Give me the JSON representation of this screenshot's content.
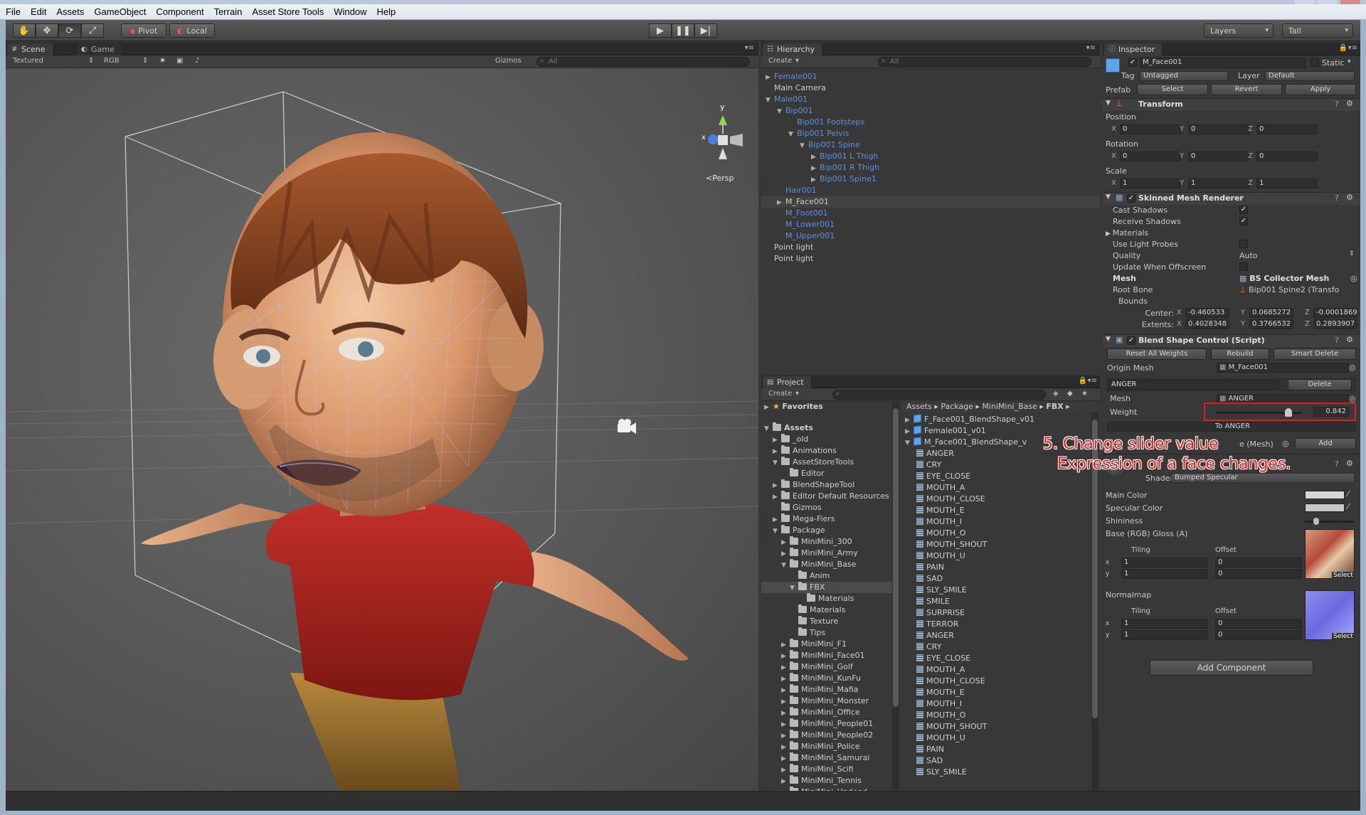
{
  "menu": [
    "File",
    "Edit",
    "Assets",
    "GameObject",
    "Component",
    "Terrain",
    "Asset Store Tools",
    "Window",
    "Help"
  ],
  "toolbar": {
    "pivot": "Pivot",
    "local": "Local",
    "layers": "Layers",
    "layout": "Tall"
  },
  "scene": {
    "tab_scene": "Scene",
    "tab_game": "Game",
    "render_mode": "Textured",
    "color_mode": "RGB",
    "gizmos": "Gizmos",
    "search_placeholder": "All",
    "persp_label": "Persp",
    "axis_y": "y",
    "axis_x": "x"
  },
  "hierarchy": {
    "title": "Hierarchy",
    "create": "Create",
    "search_placeholder": "All",
    "rows": [
      {
        "label": "Female001",
        "indent": 0,
        "arrow": "▶",
        "blue": true
      },
      {
        "label": "Main Camera",
        "indent": 0,
        "arrow": "",
        "blue": false
      },
      {
        "label": "Male001",
        "indent": 0,
        "arrow": "▼",
        "blue": true
      },
      {
        "label": "Bip001",
        "indent": 1,
        "arrow": "▼",
        "blue": true
      },
      {
        "label": "Bip001 Footsteps",
        "indent": 2,
        "arrow": "",
        "blue": true
      },
      {
        "label": "Bip001 Pelvis",
        "indent": 2,
        "arrow": "▼",
        "blue": true
      },
      {
        "label": "Bip001 Spine",
        "indent": 3,
        "arrow": "▼",
        "blue": true
      },
      {
        "label": "Bip001 L Thigh",
        "indent": 4,
        "arrow": "▶",
        "blue": true
      },
      {
        "label": "Bip001 R Thigh",
        "indent": 4,
        "arrow": "▶",
        "blue": true
      },
      {
        "label": "Bip001 Spine1",
        "indent": 4,
        "arrow": "▶",
        "blue": true
      },
      {
        "label": "Hair001",
        "indent": 1,
        "arrow": "",
        "blue": true
      },
      {
        "label": "M_Face001",
        "indent": 1,
        "arrow": "▶",
        "blue": false,
        "selected": true
      },
      {
        "label": "M_Foot001",
        "indent": 1,
        "arrow": "",
        "blue": true
      },
      {
        "label": "M_Lower001",
        "indent": 1,
        "arrow": "",
        "blue": true
      },
      {
        "label": "M_Upper001",
        "indent": 1,
        "arrow": "",
        "blue": true
      },
      {
        "label": "Point light",
        "indent": 0,
        "arrow": "",
        "blue": false
      },
      {
        "label": "Point light",
        "indent": 0,
        "arrow": "",
        "blue": false
      }
    ]
  },
  "project": {
    "title": "Project",
    "create": "Create",
    "favorites": "Favorites",
    "assets": "Assets",
    "breadcrumb": [
      "Assets",
      "Package",
      "MiniMini_Base",
      "FBX"
    ],
    "tree": [
      {
        "label": "_old",
        "indent": 1,
        "arrow": "▶"
      },
      {
        "label": "Animations",
        "indent": 1,
        "arrow": "▶"
      },
      {
        "label": "AssetStoreTools",
        "indent": 1,
        "arrow": "▼"
      },
      {
        "label": "Editor",
        "indent": 2,
        "arrow": ""
      },
      {
        "label": "BlendShapeTool",
        "indent": 1,
        "arrow": "▶"
      },
      {
        "label": "Editor Default Resources",
        "indent": 1,
        "arrow": "▶"
      },
      {
        "label": "Gizmos",
        "indent": 1,
        "arrow": ""
      },
      {
        "label": "Mega-Fiers",
        "indent": 1,
        "arrow": "▶"
      },
      {
        "label": "Package",
        "indent": 1,
        "arrow": "▼"
      },
      {
        "label": "MiniMini_300",
        "indent": 2,
        "arrow": "▶"
      },
      {
        "label": "MiniMini_Army",
        "indent": 2,
        "arrow": "▶"
      },
      {
        "label": "MiniMini_Base",
        "indent": 2,
        "arrow": "▼"
      },
      {
        "label": "Anim",
        "indent": 3,
        "arrow": ""
      },
      {
        "label": "FBX",
        "indent": 3,
        "arrow": "▼",
        "selected": true
      },
      {
        "label": "Materials",
        "indent": 4,
        "arrow": ""
      },
      {
        "label": "Materials",
        "indent": 3,
        "arrow": ""
      },
      {
        "label": "Texture",
        "indent": 3,
        "arrow": ""
      },
      {
        "label": "Tips",
        "indent": 3,
        "arrow": ""
      },
      {
        "label": "MiniMini_F1",
        "indent": 2,
        "arrow": "▶"
      },
      {
        "label": "MiniMini_Face01",
        "indent": 2,
        "arrow": "▶"
      },
      {
        "label": "MiniMini_Golf",
        "indent": 2,
        "arrow": "▶"
      },
      {
        "label": "MiniMini_KunFu",
        "indent": 2,
        "arrow": "▶"
      },
      {
        "label": "MiniMini_Mafia",
        "indent": 2,
        "arrow": "▶"
      },
      {
        "label": "MiniMini_Monster",
        "indent": 2,
        "arrow": "▶"
      },
      {
        "label": "MiniMini_Office",
        "indent": 2,
        "arrow": "▶"
      },
      {
        "label": "MiniMini_People01",
        "indent": 2,
        "arrow": "▶"
      },
      {
        "label": "MiniMini_People02",
        "indent": 2,
        "arrow": "▶"
      },
      {
        "label": "MiniMini_Police",
        "indent": 2,
        "arrow": "▶"
      },
      {
        "label": "MiniMini_Samurai",
        "indent": 2,
        "arrow": "▶"
      },
      {
        "label": "MiniMini_Scifi",
        "indent": 2,
        "arrow": "▶"
      },
      {
        "label": "MiniMini_Tennis",
        "indent": 2,
        "arrow": "▶"
      },
      {
        "label": "MiniMini_Undead",
        "indent": 2,
        "arrow": "▶"
      }
    ],
    "files": [
      {
        "label": "F_Face001_BlendShape_v01",
        "kind": "prefab",
        "arrow": "▶",
        "indent": 0
      },
      {
        "label": "Female001_v01",
        "kind": "prefab",
        "arrow": "▶",
        "indent": 0
      },
      {
        "label": "M_Face001_BlendShape_v",
        "kind": "prefab",
        "arrow": "▼",
        "indent": 0
      },
      {
        "label": "ANGER",
        "kind": "grid",
        "arrow": "",
        "indent": 1
      },
      {
        "label": "CRY",
        "kind": "grid",
        "arrow": "",
        "indent": 1
      },
      {
        "label": "EYE_CLOSE",
        "kind": "grid",
        "arrow": "",
        "indent": 1
      },
      {
        "label": "MOUTH_A",
        "kind": "grid",
        "arrow": "",
        "indent": 1
      },
      {
        "label": "MOUTH_CLOSE",
        "kind": "grid",
        "arrow": "",
        "indent": 1
      },
      {
        "label": "MOUTH_E",
        "kind": "grid",
        "arrow": "",
        "indent": 1
      },
      {
        "label": "MOUTH_I",
        "kind": "grid",
        "arrow": "",
        "indent": 1
      },
      {
        "label": "MOUTH_O",
        "kind": "grid",
        "arrow": "",
        "indent": 1
      },
      {
        "label": "MOUTH_SHOUT",
        "kind": "grid",
        "arrow": "",
        "indent": 1
      },
      {
        "label": "MOUTH_U",
        "kind": "grid",
        "arrow": "",
        "indent": 1
      },
      {
        "label": "PAIN",
        "kind": "grid",
        "arrow": "",
        "indent": 1
      },
      {
        "label": "SAD",
        "kind": "grid",
        "arrow": "",
        "indent": 1
      },
      {
        "label": "SLY_SMILE",
        "kind": "grid",
        "arrow": "",
        "indent": 1
      },
      {
        "label": "SMILE",
        "kind": "grid",
        "arrow": "",
        "indent": 1
      },
      {
        "label": "SURPRISE",
        "kind": "grid",
        "arrow": "",
        "indent": 1
      },
      {
        "label": "TERROR",
        "kind": "grid",
        "arrow": "",
        "indent": 1
      },
      {
        "label": "ANGER",
        "kind": "grid",
        "arrow": "",
        "indent": 1
      },
      {
        "label": "CRY",
        "kind": "grid",
        "arrow": "",
        "indent": 1
      },
      {
        "label": "EYE_CLOSE",
        "kind": "grid",
        "arrow": "",
        "indent": 1
      },
      {
        "label": "MOUTH_A",
        "kind": "grid",
        "arrow": "",
        "indent": 1
      },
      {
        "label": "MOUTH_CLOSE",
        "kind": "grid",
        "arrow": "",
        "indent": 1
      },
      {
        "label": "MOUTH_E",
        "kind": "grid",
        "arrow": "",
        "indent": 1
      },
      {
        "label": "MOUTH_I",
        "kind": "grid",
        "arrow": "",
        "indent": 1
      },
      {
        "label": "MOUTH_O",
        "kind": "grid",
        "arrow": "",
        "indent": 1
      },
      {
        "label": "MOUTH_SHOUT",
        "kind": "grid",
        "arrow": "",
        "indent": 1
      },
      {
        "label": "MOUTH_U",
        "kind": "grid",
        "arrow": "",
        "indent": 1
      },
      {
        "label": "PAIN",
        "kind": "grid",
        "arrow": "",
        "indent": 1
      },
      {
        "label": "SAD",
        "kind": "grid",
        "arrow": "",
        "indent": 1
      },
      {
        "label": "SLY_SMILE",
        "kind": "grid",
        "arrow": "",
        "indent": 1
      }
    ]
  },
  "inspector": {
    "title": "Inspector",
    "object_name": "M_Face001",
    "static": "Static",
    "tag_label": "Tag",
    "tag_value": "Untagged",
    "layer_label": "Layer",
    "layer_value": "Default",
    "prefab_label": "Prefab",
    "prefab_select": "Select",
    "prefab_revert": "Revert",
    "prefab_apply": "Apply",
    "transform": {
      "title": "Transform",
      "position": "Position",
      "rotation": "Rotation",
      "scale": "Scale",
      "pos": [
        "0",
        "0",
        "0"
      ],
      "rot": [
        "0",
        "0",
        "0"
      ],
      "scl": [
        "1",
        "1",
        "1"
      ]
    },
    "smr": {
      "title": "Skinned Mesh Renderer",
      "cast": "Cast Shadows",
      "receive": "Receive Shadows",
      "materials": "Materials",
      "probes": "Use Light Probes",
      "quality": "Quality",
      "quality_value": "Auto",
      "offscreen": "Update When Offscreen",
      "mesh": "Mesh",
      "mesh_value": "BS Collector Mesh",
      "rootbone": "Root Bone",
      "rootbone_value": "Bip001 Spine2 (Transfo",
      "bounds": "Bounds",
      "center": "Center:",
      "extents": "Extents:",
      "center_vals": [
        "-0.460533",
        "0.0685272",
        "-0.0001869"
      ],
      "extent_vals": [
        "0.4028348",
        "0.3766532",
        "0.2893907"
      ]
    },
    "bsc": {
      "title": "Blend Shape Control (Script)",
      "reset": "Reset All Weights",
      "rebuild": "Rebuild",
      "smart": "Smart Delete",
      "origin": "Origin Mesh",
      "origin_value": "M_Face001",
      "shape_name": "ANGER",
      "delete": "Delete",
      "mesh_label": "Mesh",
      "mesh_value": "ANGER",
      "weight_label": "Weight",
      "weight_value": "0.842",
      "weight": 0.842,
      "to_label": "To ANGER",
      "partial": "e (Mesh)",
      "add": "Add"
    },
    "material": {
      "shader_label": "Shader",
      "shader_value": "Bumped Specular",
      "main_color": "Main Color",
      "spec_color": "Specular Color",
      "shininess": "Shininess",
      "base": "Base (RGB) Gloss (A)",
      "tiling": "Tiling",
      "offset": "Offset",
      "x": "x",
      "y": "y",
      "tile_vals": [
        "1",
        "1"
      ],
      "off_vals": [
        "0",
        "0"
      ],
      "select": "Select",
      "normalmap": "Normalmap",
      "n_tile_vals": [
        "1",
        "1"
      ],
      "n_off_vals": [
        "0",
        "0"
      ]
    },
    "add_component": "Add Component"
  },
  "annotation": {
    "line1": "5. Change slider value",
    "line2": "Expression of a face changes.",
    "color": "#e41b1b"
  }
}
